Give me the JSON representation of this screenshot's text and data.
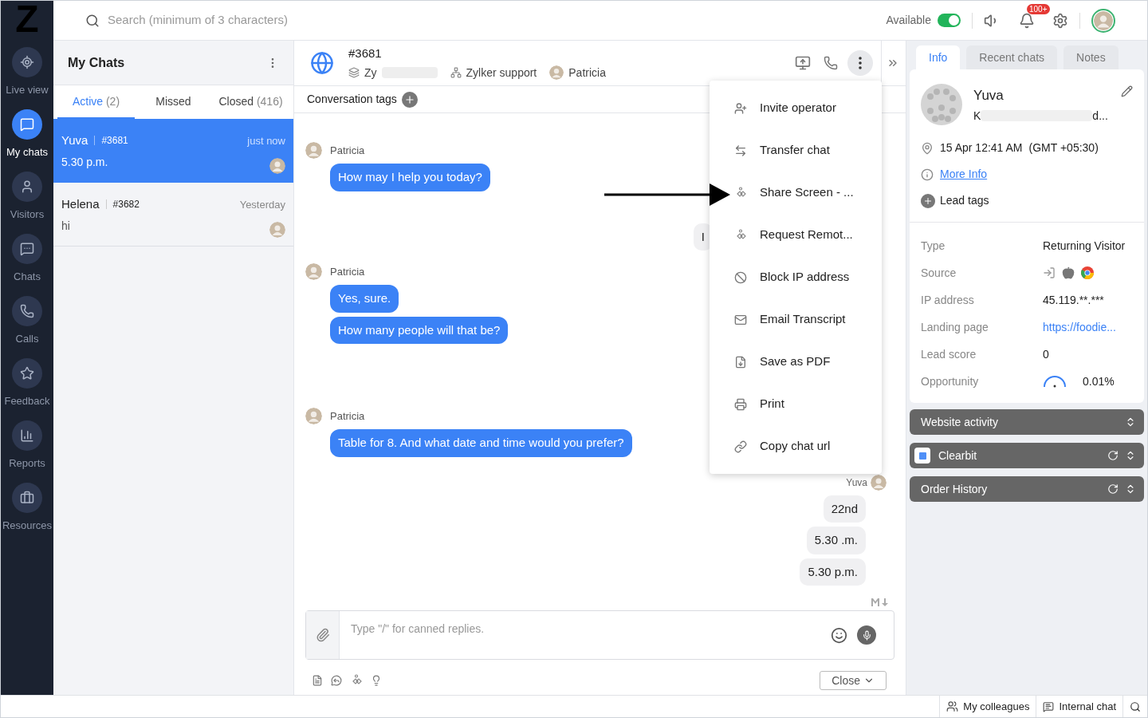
{
  "nav": {
    "logo": "Z",
    "items": [
      {
        "label": "Live view",
        "selected": false,
        "kind": "live"
      },
      {
        "label": "My chats",
        "selected": true,
        "kind": "mychats"
      },
      {
        "label": "Visitors",
        "selected": false,
        "kind": "visitors"
      },
      {
        "label": "Chats",
        "selected": false,
        "kind": "chats"
      },
      {
        "label": "Calls",
        "selected": false,
        "kind": "calls"
      },
      {
        "label": "Feedback",
        "selected": false,
        "kind": "feedback"
      },
      {
        "label": "Reports",
        "selected": false,
        "kind": "reports"
      },
      {
        "label": "Resources",
        "selected": false,
        "kind": "resources"
      }
    ]
  },
  "topbar": {
    "search_placeholder": "Search (minimum of 3 characters)",
    "status": "Available",
    "available_on": true,
    "notifications": "100+"
  },
  "chat_list": {
    "title": "My Chats",
    "tabs": [
      {
        "label": "Active",
        "count": "(2)",
        "selected": true
      },
      {
        "label": "Missed",
        "selected": false
      },
      {
        "label": "Closed",
        "count": "(416)",
        "selected": false
      }
    ],
    "chats": [
      {
        "name": "Yuva",
        "id": "#3681",
        "time": "just now",
        "preview": "5.30 p.m.",
        "selected": true
      },
      {
        "name": "Helena",
        "id": "#3682",
        "time": "Yesterday",
        "preview": "hi",
        "selected": false
      }
    ]
  },
  "conversation": {
    "id": "#3681",
    "department": "Zy",
    "group": "Zylker support",
    "operator": "Patricia",
    "tags_label": "Conversation tags",
    "messages": [
      {
        "kind": "sender",
        "text": "Patricia"
      },
      {
        "kind": "agent",
        "text": "How may I help you today?"
      },
      {
        "kind": "visitor",
        "text": "I"
      },
      {
        "kind": "sender",
        "text": "Patricia"
      },
      {
        "kind": "agent",
        "text": "Yes, sure."
      },
      {
        "kind": "agent",
        "text": "How many people will that be?"
      },
      {
        "kind": "sender",
        "text": "Patricia"
      },
      {
        "kind": "agent",
        "text": "Table for 8. And what date and time would you prefer?"
      },
      {
        "kind": "visitor_name",
        "text": "Yuva"
      },
      {
        "kind": "visitor",
        "text": "22nd"
      },
      {
        "kind": "visitor",
        "text": "5.30 .m."
      },
      {
        "kind": "visitor",
        "text": "5.30 p.m."
      }
    ],
    "composer": {
      "placeholder": "Type \"/\" for canned replies.",
      "close": "Close"
    }
  },
  "menu": [
    {
      "label": "Invite operator",
      "kind": "invite"
    },
    {
      "label": "Transfer chat",
      "kind": "transfer"
    },
    {
      "label": "Share Screen - ...",
      "kind": "share"
    },
    {
      "label": "Request Remot...",
      "kind": "share"
    },
    {
      "label": "Block IP address",
      "kind": "block"
    },
    {
      "label": "Email Transcript",
      "kind": "email"
    },
    {
      "label": "Save as PDF",
      "kind": "pdf"
    },
    {
      "label": "Print",
      "kind": "print"
    },
    {
      "label": "Copy chat url",
      "kind": "link"
    }
  ],
  "visitor": {
    "tabs": [
      {
        "label": "Info",
        "selected": true
      },
      {
        "label": "Recent chats",
        "selected": false
      },
      {
        "label": "Notes",
        "selected": false
      }
    ],
    "name": "Yuva",
    "location_start": "K",
    "location_end": "d...",
    "time": "15 Apr 12:41 AM",
    "timezone": "(GMT +05:30)",
    "more_info": "More Info",
    "lead_tags": "Lead tags",
    "fields": [
      {
        "label": "Type",
        "value": "Returning Visitor",
        "kind": "text"
      },
      {
        "label": "Source",
        "kind": "icons"
      },
      {
        "label": "IP address",
        "value": "45.119.**.***",
        "kind": "text"
      },
      {
        "label": "Landing page",
        "value": "https://foodie...",
        "kind": "link"
      },
      {
        "label": "Lead score",
        "value": "0",
        "kind": "text"
      },
      {
        "label": "Opportunity",
        "value": "0.01%",
        "kind": "gauge"
      }
    ],
    "sections": [
      {
        "title": "Website activity",
        "refresh": false,
        "logo": false
      },
      {
        "title": "Clearbit",
        "refresh": true,
        "logo": true
      },
      {
        "title": "Order History",
        "refresh": true,
        "logo": false
      }
    ]
  },
  "status_bar": [
    {
      "label": "My colleagues",
      "kind": "colleagues"
    },
    {
      "label": "Internal chat",
      "kind": "internal"
    }
  ]
}
